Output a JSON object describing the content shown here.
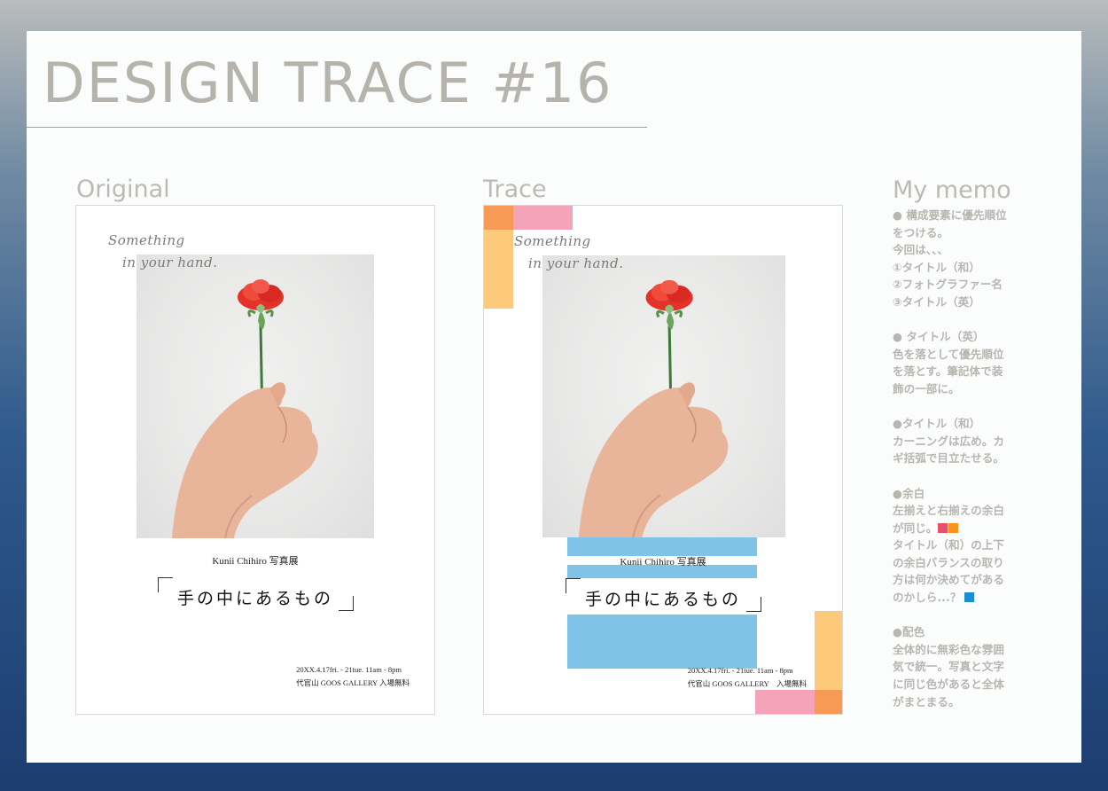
{
  "title": "DESIGN TRACE #16",
  "sections": {
    "original": "Original",
    "trace": "Trace",
    "memo": "My memo"
  },
  "poster": {
    "script_line1": "Something",
    "script_line2": "in your hand.",
    "photographer": "Kunii Chihiro 写真展",
    "jp_title": "手の中にあるもの",
    "date_line": "20XX.4.17fri. - 21tue.  11am - 8pm",
    "venue_line": "代官山 GOOS GALLERY 入場無料",
    "venue_line_trace": "代官山 GOOS GALLERY　入場無料"
  },
  "memo": {
    "b1_head": "● 構成要素に優先順位",
    "b1_l2": "をつける。",
    "b1_l3": "今回は、、、",
    "b1_l4": "①タイトル（和）",
    "b1_l5": "②フォトグラファー名",
    "b1_l6": "③タイトル（英）",
    "b2_head": "● タイトル（英）",
    "b2_l2": "色を落として優先順位",
    "b2_l3": "を落とす。筆記体で装",
    "b2_l4": "飾の一部に。",
    "b3_head": "●タイトル（和）",
    "b3_l2": "カーニングは広め。カ",
    "b3_l3": "ギ括弧で目立たせる。",
    "b4_head": "●余白",
    "b4_l2": "左揃えと右揃えの余白",
    "b4_l3": "が同じ。",
    "b4_l4": "タイトル（和）の上下",
    "b4_l5": "の余白バランスの取り",
    "b4_l6": "方は何か決めてがある",
    "b4_l7": "のかしら...？",
    "b5_head": "●配色",
    "b5_l2": "全体的に無彩色な雰囲",
    "b5_l3": "気で統一。写真と文字",
    "b5_l4": "に同じ色があると全体",
    "b5_l5": "がまとまる。"
  },
  "colors": {
    "title": "#b5b3ab",
    "guide_orange": "#f79a55",
    "guide_pink": "#f4a3b8",
    "guide_yellow": "#fdc97a",
    "guide_blue": "#7fc3e8",
    "swatch_pink": "#e8506c",
    "swatch_orange": "#f7941d",
    "swatch_blue": "#1a8fd6"
  },
  "icons": {
    "bullet": "filled-circle"
  }
}
